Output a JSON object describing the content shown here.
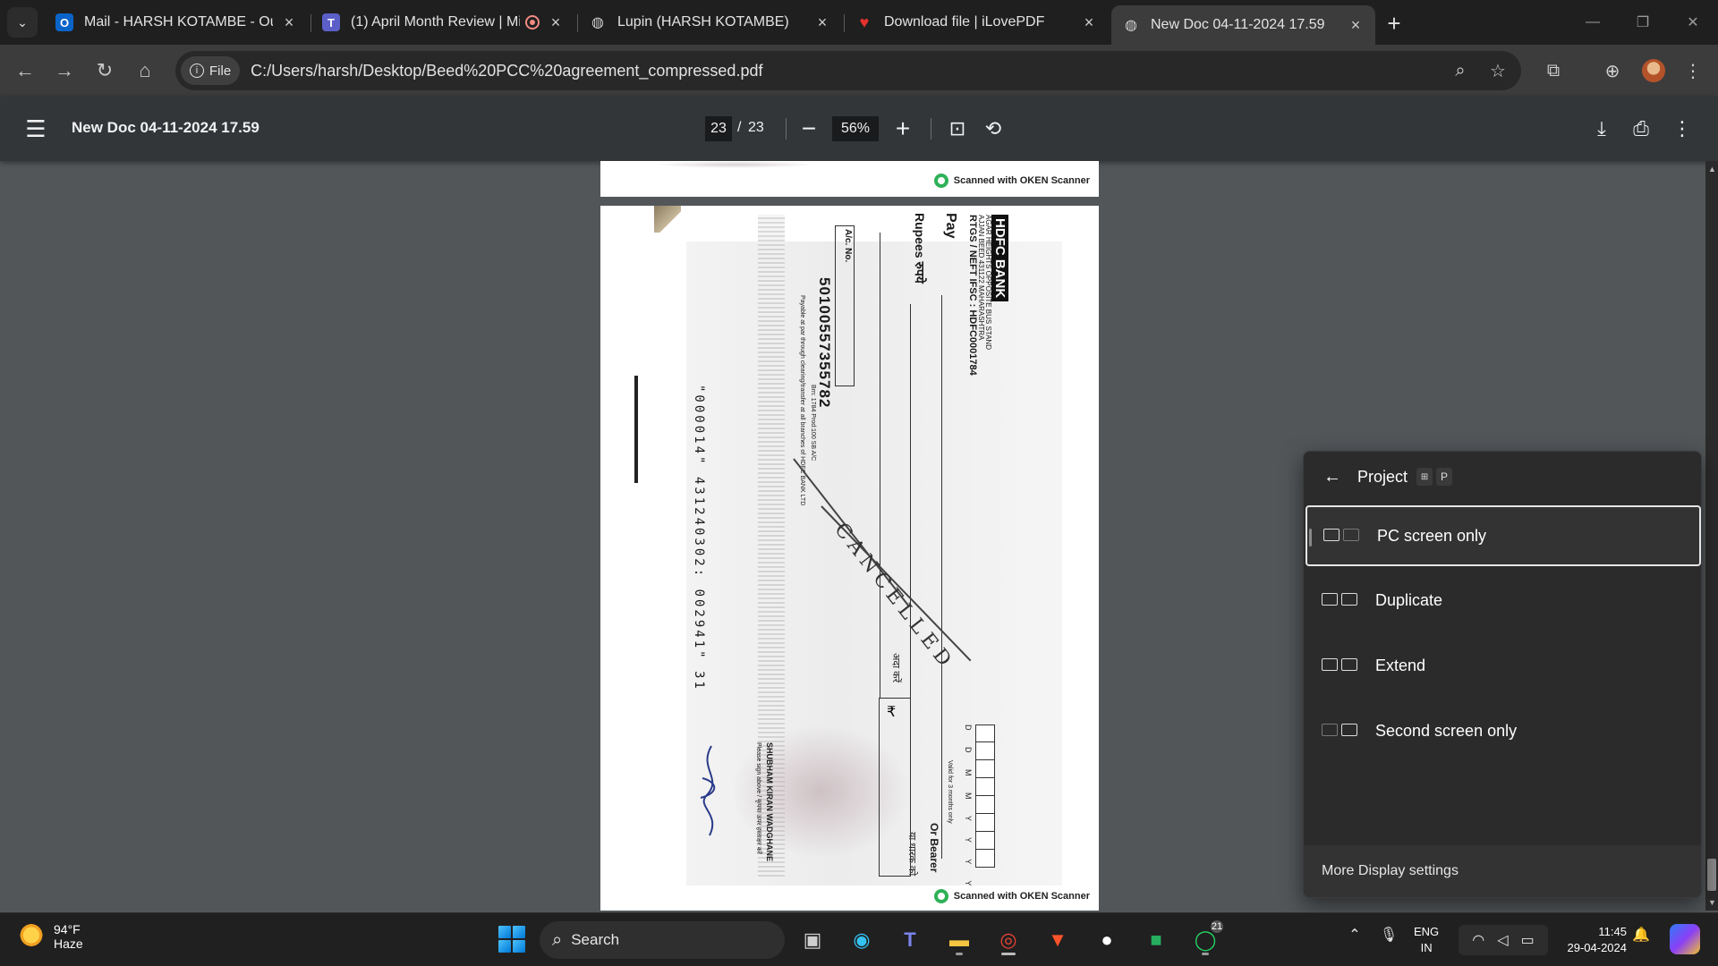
{
  "browser": {
    "tabs": [
      {
        "title": "Mail - HARSH KOTAMBE - Outlo",
        "icon": "outlook-icon",
        "active": false
      },
      {
        "title": "(1) April Month Review | Mi",
        "icon": "teams-icon",
        "active": false
      },
      {
        "title": "Lupin (HARSH KOTAMBE)",
        "icon": "globe-icon",
        "active": false
      },
      {
        "title": "Download file | iLovePDF",
        "icon": "ilovepdf-icon",
        "active": false
      },
      {
        "title": "New Doc 04-11-2024 17.59",
        "icon": "globe-icon",
        "active": true
      }
    ],
    "file_chip": "File",
    "url": "C:/Users/harsh/Desktop/Beed%20PCC%20agreement_compressed.pdf"
  },
  "pdf_viewer": {
    "title": "New Doc 04-11-2024 17.59",
    "current_page": "23",
    "page_separator": "/",
    "total_pages": "23",
    "zoom": "56%"
  },
  "document": {
    "scan_watermark": "Scanned with OKEN Scanner",
    "cheque": {
      "bank": "HDFC BANK",
      "branch_line1": "AGAR HEIGHTS OPPOSITE BUS STAND",
      "branch_line2": "AJJAN BEED 431122 MAHARASHTRA",
      "ifsc": "RTGS / NEFT IFSC : HDFC0001784",
      "pay": "Pay",
      "rupees": "Rupees रुपये",
      "account_label": "A/c. No.",
      "account_number": "50100557355782",
      "payable_note": "Payable at par through clearing/transfer at all branches of HDFC BANK LTD",
      "branch_code": "Brn: 1784 Prod:100 SB A/C",
      "bearer": "Or Bearer",
      "bearer_hindi": "या धारक को",
      "validity": "Valid for 3 months only",
      "date_label": "D D M M Y Y Y Y",
      "amount_hindi": "अदा करें",
      "rupee_symbol": "₹",
      "holder_name": "SHUBHAM KIRAN WADGHANE",
      "sign_note": "Please sign above / कृपया ऊपर हस्ताक्षर करें",
      "micr": "\"000014\" 431240302: 002941\" 31",
      "cancel_text": "CANCELLED"
    }
  },
  "project_flyout": {
    "title": "Project",
    "shortcut_key": "P",
    "options": [
      {
        "label": "PC screen only",
        "selected": true
      },
      {
        "label": "Duplicate",
        "selected": false
      },
      {
        "label": "Extend",
        "selected": false
      },
      {
        "label": "Second screen only",
        "selected": false
      }
    ],
    "footer": "More Display settings"
  },
  "taskbar": {
    "weather_temp": "94°F",
    "weather_desc": "Haze",
    "search_label": "Search",
    "lang_line1": "ENG",
    "lang_line2": "IN",
    "time": "11:45",
    "date": "29-04-2024",
    "whatsapp_badge": "21"
  }
}
